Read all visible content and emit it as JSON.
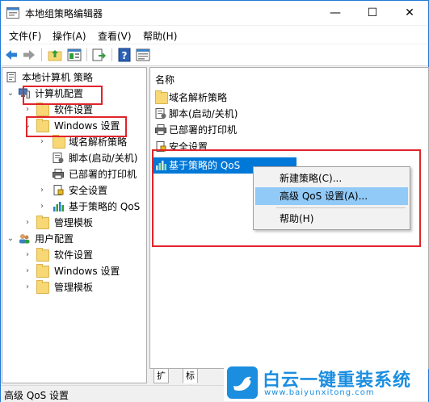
{
  "window": {
    "title": "本地组策略编辑器",
    "minimize_glyph": "—",
    "maximize_glyph": "☐",
    "close_glyph": "✕"
  },
  "menubar": {
    "items": [
      {
        "label": "文件(F)"
      },
      {
        "label": "操作(A)"
      },
      {
        "label": "查看(V)"
      },
      {
        "label": "帮助(H)"
      }
    ]
  },
  "toolbar": {
    "icons": [
      "back-arrow-icon",
      "forward-arrow-icon",
      "up-folder-icon",
      "show-hide-tree-icon",
      "export-list-icon",
      "help-icon",
      "properties-icon"
    ]
  },
  "tree": {
    "root": "本地计算机 策略",
    "computer_config": "计算机配置",
    "cc_software": "软件设置",
    "cc_windows": "Windows 设置",
    "cc_win_dns": "域名解析策略",
    "cc_win_scripts": "脚本(启动/关机)",
    "cc_win_printers": "已部署的打印机",
    "cc_win_security": "安全设置",
    "cc_win_qos": "基于策略的 QoS",
    "cc_admin": "管理模板",
    "user_config": "用户配置",
    "uc_software": "软件设置",
    "uc_windows": "Windows 设置",
    "uc_admin": "管理模板"
  },
  "list": {
    "column_header": "名称",
    "items": [
      {
        "label": "域名解析策略",
        "icon": "folder-icon"
      },
      {
        "label": "脚本(启动/关机)",
        "icon": "script-icon"
      },
      {
        "label": "已部署的打印机",
        "icon": "printer-icon"
      },
      {
        "label": "安全设置",
        "icon": "security-icon"
      },
      {
        "label": "基于策略的 QoS",
        "icon": "qos-chart-icon"
      }
    ]
  },
  "context_menu": {
    "items": [
      {
        "label": "新建策略(C)..."
      },
      {
        "label": "高级 QoS 设置(A)..."
      },
      {
        "label": "帮助(H)"
      }
    ]
  },
  "tabs": {
    "extended": "扩展",
    "standard": "标准"
  },
  "statusbar": {
    "text": "高级 QoS 设置"
  },
  "brand": {
    "name": "白云一键重装系统",
    "url": "www.baiyunxitong.com"
  },
  "colors": {
    "highlight": "#0078d7",
    "menu_highlight": "#91c9f7",
    "annotation_red": "#e0242b",
    "folder": "#f8d775",
    "brand_blue": "#1b8ee0"
  }
}
